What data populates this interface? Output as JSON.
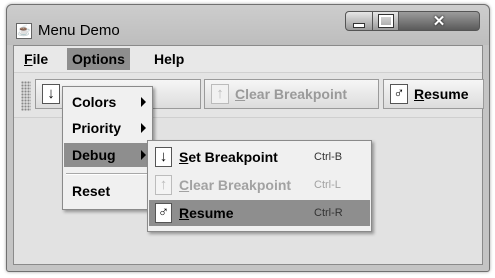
{
  "window": {
    "title": "Menu Demo",
    "icon": "java-cup-icon",
    "title_icon_glyph": "☕",
    "close_glyph": "✕"
  },
  "menubar": {
    "file": {
      "mnemonic": "F",
      "rest": "ile"
    },
    "options": "Options",
    "help": "Help"
  },
  "toolbar": {
    "set_breakpoint": {
      "icon_glyph": "↓",
      "label": "kpoint"
    },
    "clear_breakpoint": {
      "icon_glyph": "↑",
      "mnemonic": "C",
      "rest": "lear Breakpoint"
    },
    "resume": {
      "icon_glyph": "♂",
      "mnemonic": "R",
      "rest": "esume"
    }
  },
  "options_menu": {
    "items": [
      {
        "label": "Colors",
        "submenu": true
      },
      {
        "label": "Priority",
        "submenu": true
      },
      {
        "label": "Debug",
        "submenu": true,
        "selected": true
      },
      {
        "label": "Reset",
        "submenu": false
      }
    ]
  },
  "debug_menu": {
    "items": [
      {
        "icon": "arrow-down-icon",
        "glyph": "↓",
        "mnemonic": "S",
        "rest": "et Breakpoint",
        "accelerator": "Ctrl-B",
        "enabled": true,
        "selected": false
      },
      {
        "icon": "arrow-up-icon",
        "glyph": "↑",
        "mnemonic": "C",
        "rest": "lear Breakpoint",
        "accelerator": "Ctrl-L",
        "enabled": false,
        "selected": false
      },
      {
        "icon": "resume-icon",
        "glyph": "♂",
        "mnemonic": "R",
        "rest": "esume",
        "accelerator": "Ctrl-R",
        "enabled": true,
        "selected": true
      }
    ]
  },
  "colors": {
    "selection": "#8e8e8e",
    "disabled_text": "#a2a2a2"
  }
}
